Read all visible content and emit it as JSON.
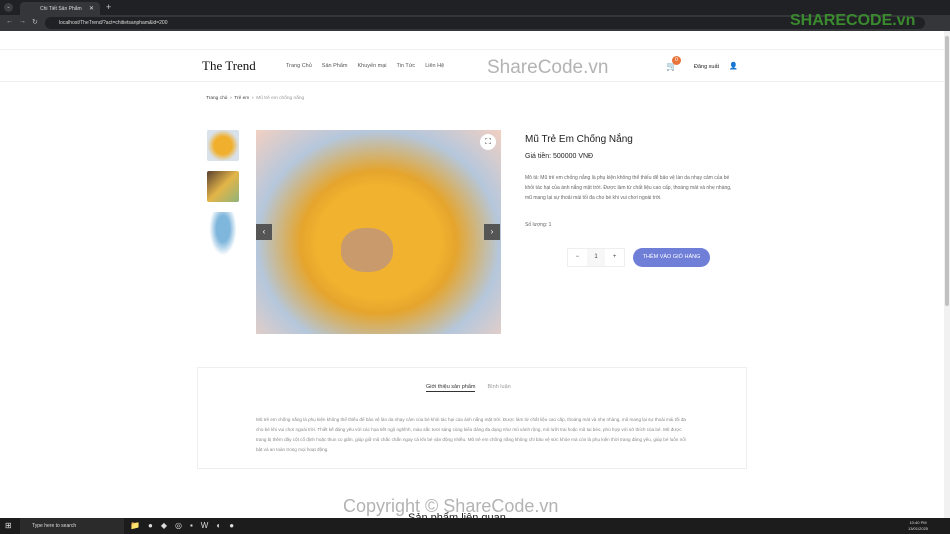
{
  "browser": {
    "tab_title": "Chi Tiết Sản Phẩm",
    "url": "localhost/TheTrend/?act=chitietsanpham&id=200"
  },
  "header": {
    "logo": "The Trend",
    "nav": [
      "Trang Chủ",
      "Sản Phẩm",
      "Khuyến mại",
      "Tin Tức",
      "Liên Hệ"
    ],
    "cart_count": "0",
    "logout": "Đăng xuất"
  },
  "breadcrumb": [
    "Trang chủ",
    "Trẻ em",
    "Mũ trẻ em chống nắng"
  ],
  "product": {
    "title": "Mũ Trẻ Em Chống Nắng",
    "price": "Giá tiền: 500000 VNĐ",
    "description": "Mô tả: Mũ trẻ em chống nắng là phụ kiện không thể thiếu để bảo vệ làn da nhạy cảm của bé khỏi tác hại của ánh nắng mặt trời. Được làm từ chất liệu cao cấp, thoáng mát và nhẹ nhàng, mũ mang lại sự thoải mái tối đa cho bé khi vui chơi ngoài trời.",
    "stock": "Số lượng: 1",
    "qty": "1",
    "minus": "−",
    "plus": "+",
    "add_to_cart": "THÊM VÀO GIỎ HÀNG"
  },
  "tabs": {
    "items": [
      "Giới thiệu sản phẩm",
      "Bình luận"
    ],
    "content": "Mũ trẻ em chống nắng là phụ kiện không thể thiếu để bảo vệ làn da nhạy cảm của bé khỏi tác hại của ánh nắng mặt trời. Được làm từ chất liệu cao cấp, thoáng mát và nhẹ nhàng, mũ mang lại sự thoải mái tối đa cho bé khi vui chơi ngoài trời. Thiết kế đáng yêu với các họa tiết ngộ nghĩnh, màu sắc tươi sáng cùng kiểu dáng đa dạng như mũ vành rộng, mũ lưỡi trai hoặc mũ tai bèo, phù hợp với sở thích của bé. Mũ được trang bị thêm dây cột cổ định hoặc thun co giãn, giúp giữ mũ chắc chắn ngay cả khi bé vận động nhiều. Mũ trẻ em chống nắng không chỉ bảo vệ sức khỏe mà còn là phụ kiện thời trang đáng yêu, giúp bé luôn nổi bật và an toàn trong mọi hoạt động."
  },
  "related_title": "Sản phẩm liên quan",
  "watermark": {
    "logo": "SHARECODE.vn",
    "center": "ShareCode.vn",
    "copyright": "Copyright © ShareCode.vn"
  },
  "taskbar": {
    "search": "Type here to search",
    "time": "10:40 PM",
    "date": "13/01/2025"
  },
  "colors": {
    "accent": "#6f7fd8",
    "badge": "#e8743b"
  }
}
